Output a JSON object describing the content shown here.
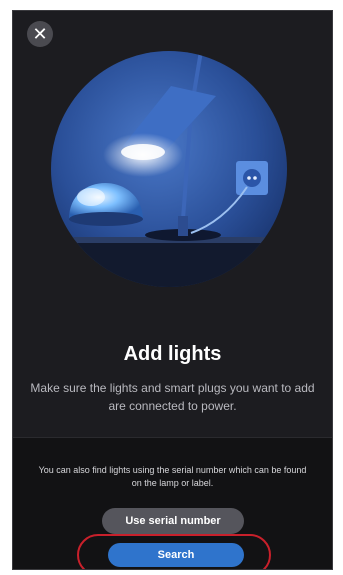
{
  "header": {
    "close_icon": "close-icon",
    "close_glyph": "✕"
  },
  "hero": {
    "illustration": "lamp-and-light-illustration"
  },
  "main": {
    "title": "Add lights",
    "subtitle": "Make sure the lights and smart plugs you want to add are connected to power."
  },
  "bottom": {
    "hint": "You can also find lights using the serial number which can be found on the lamp or label.",
    "serial_button_label": "Use serial number",
    "search_button_label": "Search"
  },
  "colors": {
    "background": "#1c1c20",
    "search_button": "#2f74cc",
    "highlight_ring": "#c8202b"
  }
}
